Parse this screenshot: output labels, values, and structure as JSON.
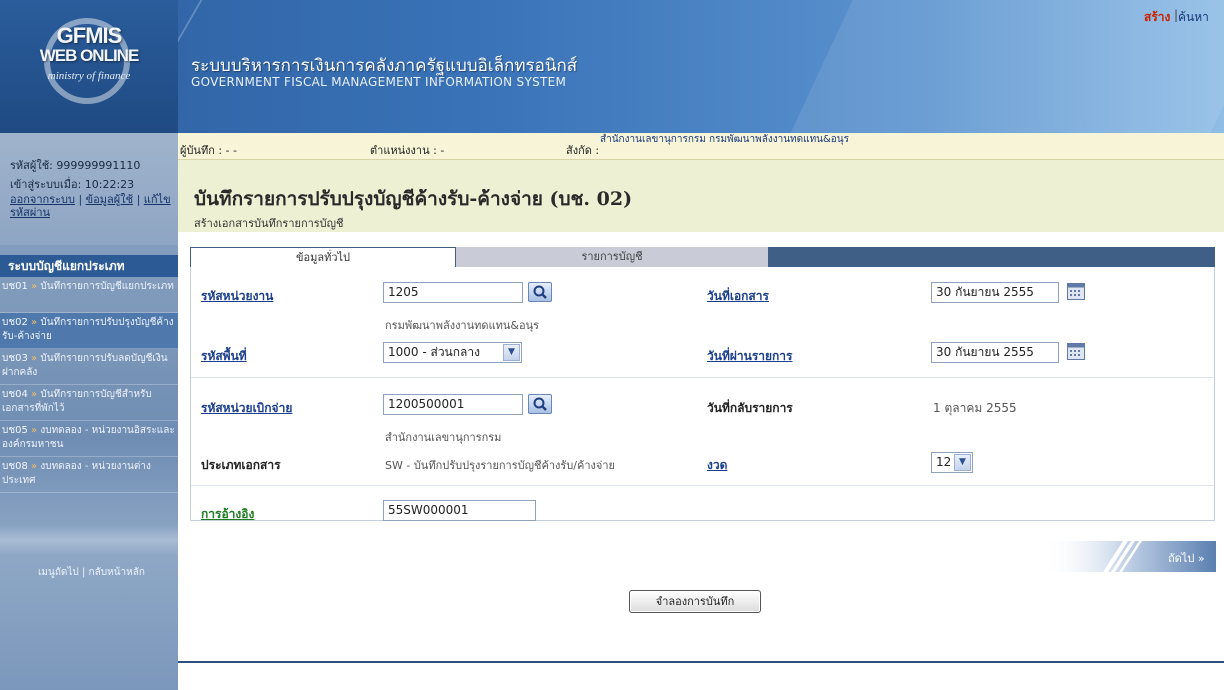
{
  "header": {
    "logo_title": "GFMIS",
    "logo_title2": "WEB ONLINE",
    "logo_sub": "ministry of finance",
    "system_name_thai": "ระบบบริหารการเงินการคลังภาครัฐแบบอิเล็กทรอนิกส์",
    "system_name_eng": "GOVERNMENT FISCAL MANAGEMENT INFORMATION SYSTEM"
  },
  "sidebar": {
    "user_label": "รหัสผู้ใช้: 999999991110",
    "login_label": "เข้าสู่ระบบเมื่อ: 10:22:23",
    "logout": "ออกจากระบบ",
    "user_info": "ข้อมูลผู้ใช้",
    "change_password": "แก้ไขรหัสผ่าน",
    "menu_title": "ระบบบัญชีแยกประเภท",
    "menu_items": [
      {
        "code": "บช01",
        "label": "บันทึกรายการบัญชีแยกประเภท"
      },
      {
        "code": "บช02",
        "label": "บันทึกรายการปรับปรุงบัญชีค้างรับ-ค้างจ่าย"
      },
      {
        "code": "บช03",
        "label": "บันทึกรายการปรับลดบัญชีเงินฝากคลัง"
      },
      {
        "code": "บช04",
        "label": "บันทึกรายการบัญชีสำหรับเอกสารที่พักไว้"
      },
      {
        "code": "บช05",
        "label": "งบทดลอง - หน่วยงานอิสระและองค์กรมหาชน"
      },
      {
        "code": "บช08",
        "label": "งบทดลอง - หน่วยงานต่างประเทศ"
      }
    ],
    "next_menu": "เมนูถัดไป",
    "home": "กลับหน้าหลัก"
  },
  "infobar": {
    "recorder_label": "ผู้บันทึก : - -",
    "position_label": "ตำแหน่งงาน : -",
    "affiliation_label": "สังกัด :",
    "affiliation_value": "สำนักงานเลขานุการกรม กรมพัฒนาพลังงานทดแทน&อนุร",
    "create": "สร้าง",
    "search": "ค้นหา"
  },
  "page": {
    "title": "บันทึกรายการปรับปรุงบัญชีค้างรับ-ค้างจ่าย (บช. 02)",
    "subtitle": "สร้างเอกสารบันทึกรายการบัญชี"
  },
  "tabs": [
    "ข้อมูลทั่วไป",
    "รายการบัญชี"
  ],
  "form": {
    "unit_code_label": "รหัสหน่วยงาน",
    "unit_code_value": "1205",
    "unit_name": "กรมพัฒนาพลังงานทดแทน&อนุร",
    "doc_date_label": "วันที่เอกสาร",
    "doc_date_value": "30 กันยายน 2555",
    "area_code_label": "รหัสพื้นที่",
    "area_code_value": "1000 - ส่วนกลาง",
    "posting_date_label": "วันที่ผ่านรายการ",
    "posting_date_value": "30 กันยายน 2555",
    "disb_unit_label": "รหัสหน่วยเบิกจ่าย",
    "disb_unit_value": "1200500001",
    "disb_unit_name": "สำนักงานเลขานุการกรม",
    "reverse_date_label": "วันที่กลับรายการ",
    "reverse_date_value": "1 ตุลาคม 2555",
    "doc_type_label": "ประเภทเอกสาร",
    "doc_type_value": "SW - บันทึกปรับปรุงรายการบัญชีค้างรับ/ค้างจ่าย",
    "period_label": "งวด",
    "period_value": "12",
    "reference_label": "การอ้างอิง",
    "reference_value": "55SW000001"
  },
  "buttons": {
    "next": "ถัดไป »",
    "simulate": "จำลองการบันทึก"
  }
}
